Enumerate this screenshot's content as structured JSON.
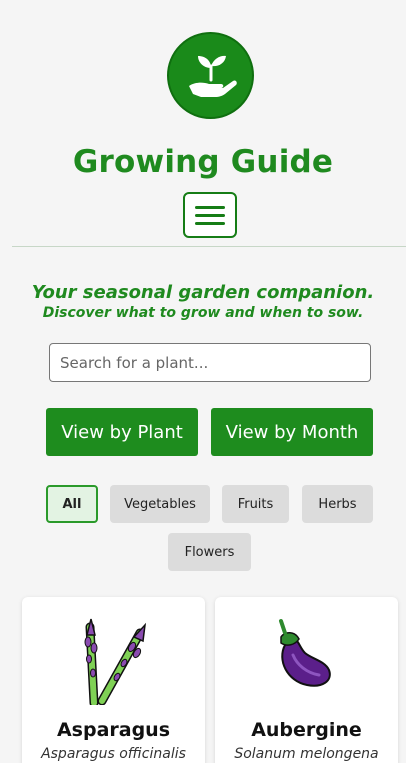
{
  "header": {
    "logo_icon": "seedling-in-hand-icon",
    "title": "Growing Guide",
    "menu_icon": "hamburger-menu-icon"
  },
  "intro": {
    "tagline": "Your seasonal garden companion.",
    "subtagline": "Discover what to grow and when to sow."
  },
  "search": {
    "placeholder": "Search for a plant...",
    "value": ""
  },
  "views": {
    "by_plant": "View by Plant",
    "by_month": "View by Month"
  },
  "filters": {
    "selected": "All",
    "options": [
      "All",
      "Vegetables",
      "Fruits",
      "Herbs",
      "Flowers"
    ]
  },
  "plants": [
    {
      "name": "Asparagus",
      "latin": "Asparagus officinalis",
      "icon": "asparagus-icon"
    },
    {
      "name": "Aubergine",
      "latin": "Solanum melongena",
      "icon": "aubergine-icon"
    }
  ],
  "colors": {
    "brand_green": "#1e8c1e",
    "background": "#f5f5f5"
  }
}
